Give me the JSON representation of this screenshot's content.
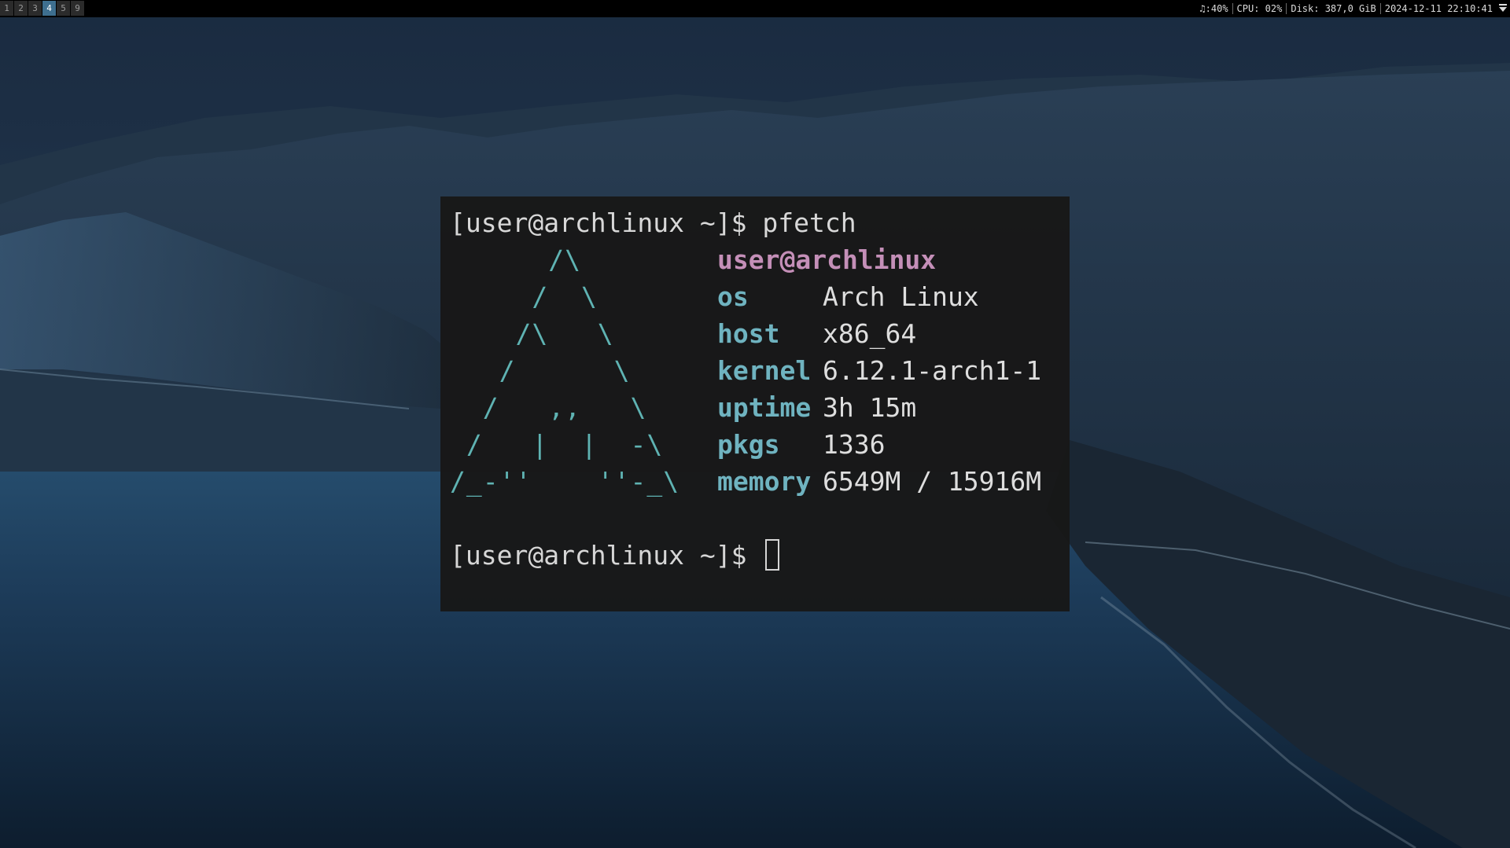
{
  "workspaces": [
    {
      "label": "1",
      "active": false
    },
    {
      "label": "2",
      "active": false
    },
    {
      "label": "3",
      "active": false
    },
    {
      "label": "4",
      "active": true
    },
    {
      "label": "5",
      "active": false
    },
    {
      "label": "9",
      "active": false
    }
  ],
  "status": {
    "volume": "♫:40%",
    "cpu": "CPU: 02%",
    "disk": "Disk: 387,0 GiB",
    "datetime": "2024-12-11 22:10:41",
    "tray_icon": "chevron-down-icon"
  },
  "terminal": {
    "prompt": "[user@archlinux ~]$ ",
    "command": "pfetch",
    "logo_lines": [
      "      /\\",
      "     /  \\",
      "    /\\   \\",
      "   /      \\",
      "  /   ,,   \\",
      " /   |  |  -\\",
      "/_-''    ''-_\\"
    ],
    "title": "user@archlinux",
    "info": [
      {
        "key": "os",
        "value": "Arch Linux"
      },
      {
        "key": "host",
        "value": "x86_64"
      },
      {
        "key": "kernel",
        "value": "6.12.1-arch1-1"
      },
      {
        "key": "uptime",
        "value": "3h 15m"
      },
      {
        "key": "pkgs",
        "value": "1336"
      },
      {
        "key": "memory",
        "value": "6549M / 15916M"
      }
    ],
    "prompt2": "[user@archlinux ~]$ "
  },
  "colors": {
    "bar_bg": "#000000",
    "workspace_active": "#3e6f8f",
    "terminal_bg": "#181818",
    "logo": "#5fb3b3",
    "info_key": "#6fb3c0",
    "title": "#c48fb8"
  }
}
